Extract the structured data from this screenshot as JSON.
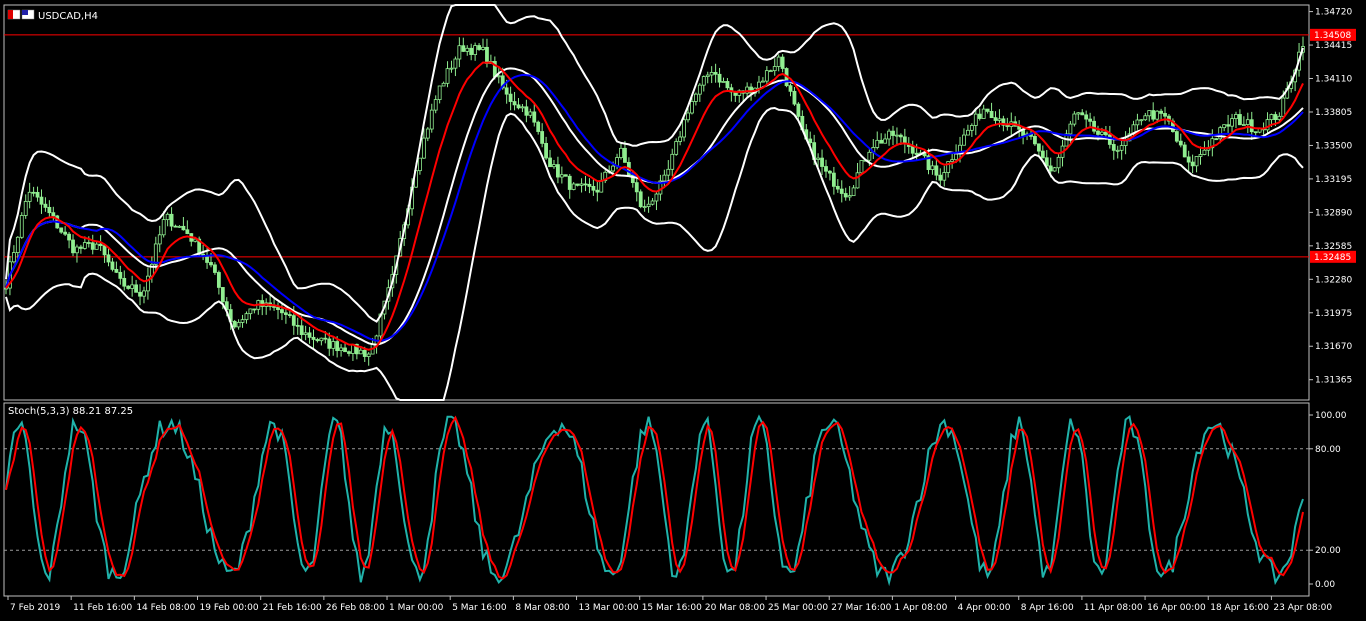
{
  "window": {
    "symbol_title": "USDCAD,H4",
    "flag_icon": "us-ca-flag-icon"
  },
  "colors": {
    "background": "#000000",
    "candle": "#90EE90",
    "bands": "#FFFFFF",
    "ma_fast": "#FF0000",
    "ma_slow": "#0000FF",
    "stoch_main": "#20B2AA",
    "stoch_signal": "#FF0000",
    "hline": "#FF0000",
    "price_tag_bg": "#FF0000"
  },
  "chart_data": [
    {
      "type": "candlestick",
      "title": "USDCAD,H4",
      "ylim": [
        1.3118,
        1.3478
      ],
      "y_ticks": [
        "1.34720",
        "1.34415",
        "1.34110",
        "1.33805",
        "1.33500",
        "1.33195",
        "1.32890",
        "1.32585",
        "1.32280",
        "1.31975",
        "1.31670",
        "1.31365"
      ],
      "x_ticks": [
        "7 Feb 2019",
        "11 Feb 16:00",
        "14 Feb 08:00",
        "19 Feb 00:00",
        "21 Feb 16:00",
        "26 Feb 08:00",
        "1 Mar 00:00",
        "5 Mar 16:00",
        "8 Mar 08:00",
        "13 Mar 00:00",
        "15 Mar 16:00",
        "20 Mar 08:00",
        "25 Mar 00:00",
        "27 Mar 16:00",
        "1 Apr 08:00",
        "4 Apr 00:00",
        "8 Apr 16:00",
        "11 Apr 08:00",
        "16 Apr 00:00",
        "18 Apr 16:00",
        "23 Apr 08:00"
      ],
      "horizontal_lines": [
        {
          "price": 1.34508,
          "label": "1.34508"
        },
        {
          "price": 1.32485,
          "label": "1.32485"
        }
      ],
      "price_anchors": [
        1.3225,
        1.331,
        1.3285,
        1.3255,
        1.326,
        1.3225,
        1.3215,
        1.3285,
        1.327,
        1.324,
        1.3185,
        1.3205,
        1.32,
        1.318,
        1.317,
        1.3165,
        1.316,
        1.323,
        1.333,
        1.34,
        1.344,
        1.3435,
        1.3395,
        1.338,
        1.333,
        1.331,
        1.331,
        1.3345,
        1.329,
        1.332,
        1.3385,
        1.342,
        1.3395,
        1.3405,
        1.343,
        1.336,
        1.3325,
        1.3305,
        1.335,
        1.336,
        1.3345,
        1.332,
        1.3355,
        1.3385,
        1.337,
        1.3355,
        1.3325,
        1.338,
        1.336,
        1.3345,
        1.338,
        1.3375,
        1.333,
        1.3355,
        1.3375,
        1.3365,
        1.338,
        1.3445
      ],
      "series": [
        {
          "type": "bollinger",
          "color_key": "bands"
        },
        {
          "type": "moving_average",
          "color_key": "ma_fast",
          "period": 10
        },
        {
          "type": "moving_average",
          "color_key": "ma_slow",
          "period": 24
        }
      ]
    },
    {
      "type": "line",
      "title": "Stoch(5,3,3) 88.21 87.25",
      "ylim": [
        0,
        100
      ],
      "y_ticks": [
        "100.00",
        "80.00",
        "20.00",
        "0.00"
      ],
      "levels": [
        80,
        20
      ],
      "series": [
        {
          "name": "main",
          "color_key": "stoch_main"
        },
        {
          "name": "signal",
          "color_key": "stoch_signal"
        }
      ]
    }
  ]
}
